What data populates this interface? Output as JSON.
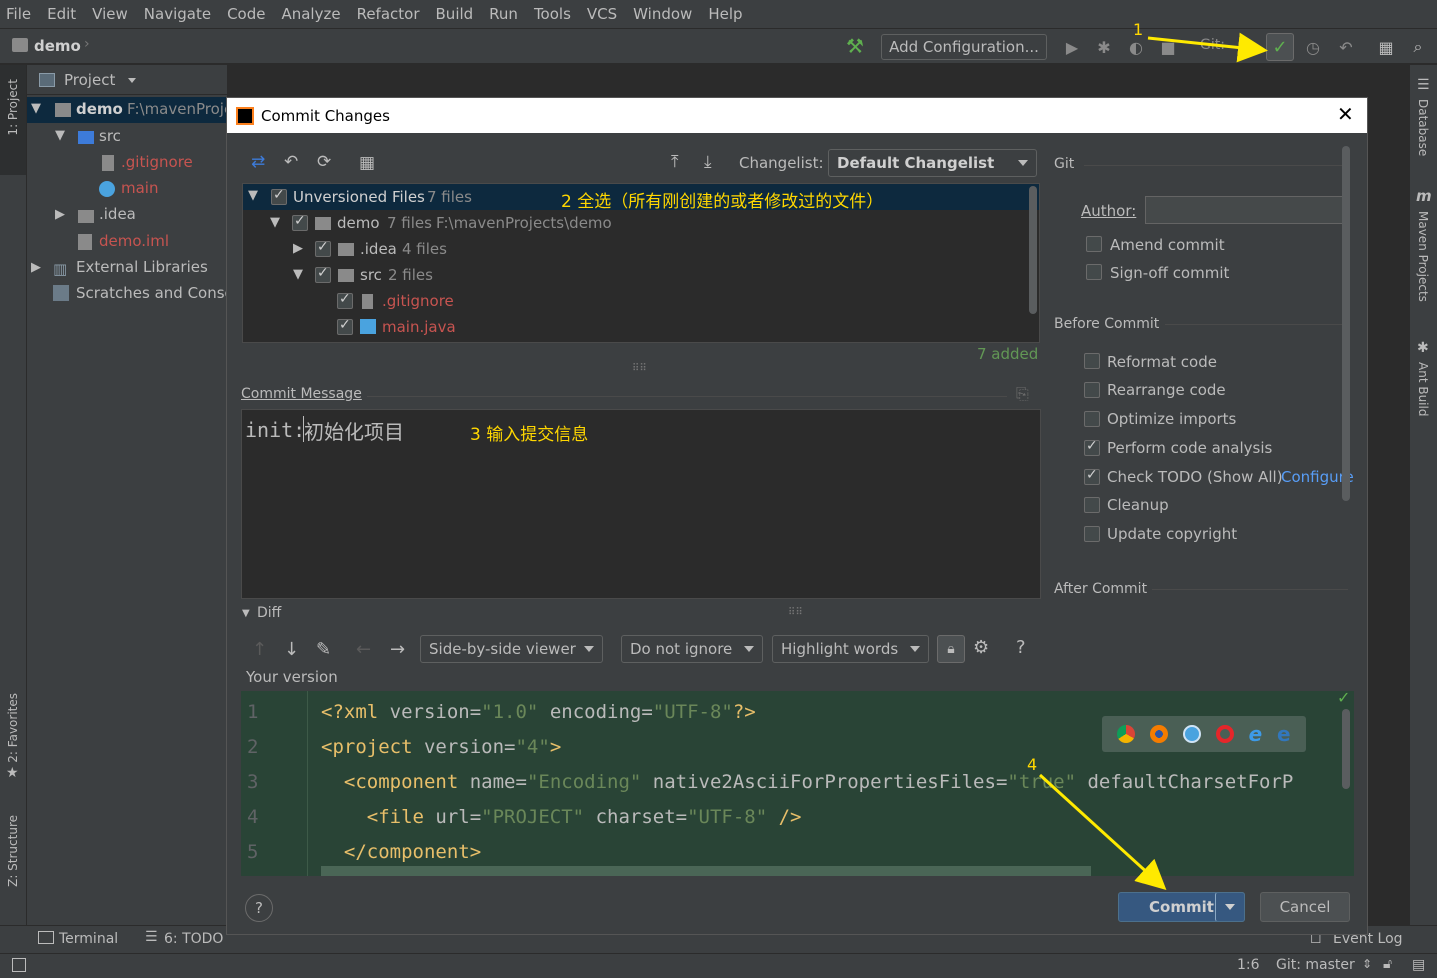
{
  "menu": [
    "File",
    "Edit",
    "View",
    "Navigate",
    "Code",
    "Analyze",
    "Refactor",
    "Build",
    "Run",
    "Tools",
    "VCS",
    "Window",
    "Help"
  ],
  "navbar": {
    "project_name": "demo",
    "add_config": "Add Configuration...",
    "git_label": "Git:"
  },
  "left_stripe": {
    "project_tab": "1: Project",
    "favorites_tab": "2: Favorites",
    "structure_tab": "Z: Structure"
  },
  "right_stripe": {
    "database_tab": "Database",
    "maven_tab": "Maven Projects",
    "ant_tab": "Ant Build"
  },
  "project_panel": {
    "title": "Project",
    "tree": [
      {
        "label": "demo",
        "path": "F:\\mavenProje"
      },
      {
        "label": "src"
      },
      {
        "label": ".gitignore"
      },
      {
        "label": "main"
      },
      {
        "label": ".idea"
      },
      {
        "label": "demo.iml"
      },
      {
        "label": "External Libraries"
      },
      {
        "label": "Scratches and Conso"
      }
    ]
  },
  "dialog": {
    "title": "Commit Changes",
    "changelist_label": "Changelist:",
    "changelist_value": "Default Changelist",
    "tree": {
      "root": {
        "label": "Unversioned Files",
        "count": "7 files"
      },
      "demo": {
        "label": "demo",
        "count": "7 files",
        "path": "F:\\mavenProjects\\demo"
      },
      "idea": {
        "label": ".idea",
        "count": "4 files"
      },
      "src": {
        "label": "src",
        "count": "2 files"
      },
      "gitignore": {
        "label": ".gitignore"
      },
      "main": {
        "label": "main.java"
      }
    },
    "added_count": "7 added",
    "commit_message_label": "Commit Message",
    "commit_message": {
      "prefix": "init:",
      "text": "初始化项目"
    },
    "git_section": "Git",
    "author_label": "Author:",
    "amend": "Amend commit",
    "signoff": "Sign-off commit",
    "before_commit": "Before Commit",
    "options": [
      {
        "label": "Reformat code",
        "checked": false
      },
      {
        "label": "Rearrange code",
        "checked": false
      },
      {
        "label": "Optimize imports",
        "checked": false
      },
      {
        "label": "Perform code analysis",
        "checked": true
      },
      {
        "label": "Check TODO (Show All)",
        "checked": true
      },
      {
        "label": "Cleanup",
        "checked": false
      },
      {
        "label": "Update copyright",
        "checked": false
      }
    ],
    "configure_link": "Configure",
    "after_commit": "After Commit",
    "diff_label": "Diff",
    "viewer": "Side-by-side viewer",
    "ignore": "Do not ignore",
    "highlight": "Highlight words",
    "your_version": "Your version",
    "code": [
      {
        "n": "1",
        "parts": [
          {
            "t": "<?xml ",
            "c": "#e8bf6a"
          },
          {
            "t": "version",
            "c": "#bababa"
          },
          {
            "t": "=",
            "c": "#bababa"
          },
          {
            "t": "\"1.0\"",
            "c": "#6a8759"
          },
          {
            "t": " encoding",
            "c": "#bababa"
          },
          {
            "t": "=",
            "c": "#bababa"
          },
          {
            "t": "\"UTF-8\"",
            "c": "#6a8759"
          },
          {
            "t": "?>",
            "c": "#e8bf6a"
          }
        ]
      },
      {
        "n": "2",
        "parts": [
          {
            "t": "<project ",
            "c": "#e8bf6a"
          },
          {
            "t": "version",
            "c": "#bababa"
          },
          {
            "t": "=",
            "c": "#bababa"
          },
          {
            "t": "\"4\"",
            "c": "#6a8759"
          },
          {
            "t": ">",
            "c": "#e8bf6a"
          }
        ]
      },
      {
        "n": "3",
        "parts": [
          {
            "t": "  <component ",
            "c": "#e8bf6a"
          },
          {
            "t": "name",
            "c": "#bababa"
          },
          {
            "t": "=",
            "c": "#bababa"
          },
          {
            "t": "\"Encoding\"",
            "c": "#6a8759"
          },
          {
            "t": " native2AsciiForPropertiesFiles",
            "c": "#bababa"
          },
          {
            "t": "=",
            "c": "#bababa"
          },
          {
            "t": "\"true\"",
            "c": "#6a8759"
          },
          {
            "t": " defaultCharsetForP",
            "c": "#bababa"
          }
        ]
      },
      {
        "n": "4",
        "parts": [
          {
            "t": "    <file ",
            "c": "#e8bf6a"
          },
          {
            "t": "url",
            "c": "#bababa"
          },
          {
            "t": "=",
            "c": "#bababa"
          },
          {
            "t": "\"PROJECT\"",
            "c": "#6a8759"
          },
          {
            "t": " charset",
            "c": "#bababa"
          },
          {
            "t": "=",
            "c": "#bababa"
          },
          {
            "t": "\"UTF-8\"",
            "c": "#6a8759"
          },
          {
            "t": " />",
            "c": "#e8bf6a"
          }
        ]
      },
      {
        "n": "5",
        "parts": [
          {
            "t": "  </component>",
            "c": "#e8bf6a"
          }
        ]
      }
    ],
    "commit_button": "Commit",
    "cancel_button": "Cancel"
  },
  "annotations": {
    "a1": "1",
    "a2": "2 全选（所有刚创建的或者修改过的文件）",
    "a3": "3 输入提交信息",
    "a4": "4"
  },
  "bottom": {
    "terminal": "Terminal",
    "todo": "6: TODO",
    "event_log": "Event Log"
  },
  "status": {
    "position": "1:6",
    "git": "Git: master"
  }
}
